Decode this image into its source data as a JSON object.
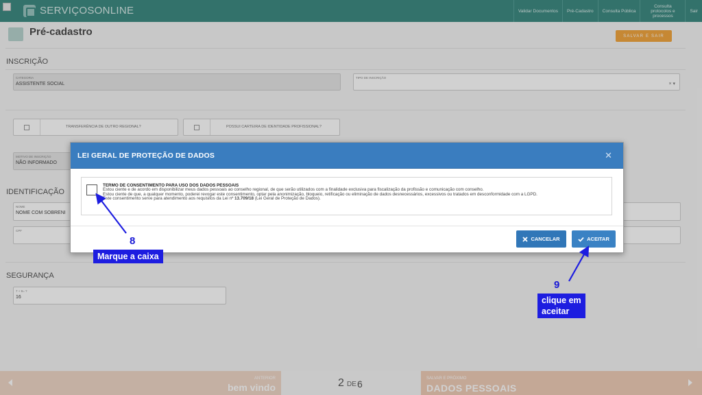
{
  "header": {
    "brand": "SERVIÇOSONLINE",
    "nav": [
      "Validar Documentos",
      "Pré-Cadastro",
      "Consulta Pública",
      "Consulta protocolos e processos",
      "Sair"
    ]
  },
  "page": {
    "title": "Pré-cadastro",
    "save_exit_label": "SALVAR E SAIR"
  },
  "inscricao": {
    "section_title": "INSCRIÇÃO",
    "categoria_label": "CATEGORIA",
    "categoria_value": "ASSISTENTE SOCIAL",
    "tipo_label": "TIPO DE INSCRIÇÃO",
    "tipo_clear": "× ▾",
    "transferencia_label": "TRANSFERÊNCIA DE OUTRO REGIONAL?",
    "carteira_label": "POSSUI CARTEIRA DE IDENTIDADE PROFISSIONAL?",
    "motivo_label": "MOTIVO DE INSCRIÇÃO",
    "motivo_value": "NÃO INFORMADO"
  },
  "identificacao": {
    "section_title": "IDENTIFICAÇÃO",
    "nome_label": "NOME",
    "nome_value": "NOME COM SOBRENI",
    "cpf_label": "CPF"
  },
  "seguranca": {
    "section_title": "SEGURANÇA",
    "captcha_label": "7 + 9= ?",
    "captcha_value": "16"
  },
  "modal": {
    "title": "LEI GERAL DE PROTEÇÃO DE DADOS",
    "consent_title": "TERMO DE CONSENTIMENTO PARA USO DOS DADOS PESSOAIS",
    "consent_p1": "Estou ciente e de acordo em disponibilizar meus dados pessoais ao conselho regional, de que serão utilizados com a finalidade exclusiva para fiscalização da profissão e comunicação com conselho.",
    "consent_p2": "Estou ciente de que, a qualquer momento, poderei revogar este consentimento, optar pela anonimização, bloqueio, retificação ou eliminação de dados desnecessários, excessivos ou tratados em desconformidade com a LGPD.",
    "consent_p3_pre": "Este consentimento serve para atendimento aos requisitos da Lei nº ",
    "consent_p3_law": "13.709/18",
    "consent_p3_post": " (Lei Geral de Proteção de Dados).",
    "cancel_label": "CANCELAR",
    "accept_label": "ACEITAR"
  },
  "annotations": {
    "step8_number": "8",
    "step8_text": "Marque a caixa",
    "step9_number": "9",
    "step9_line1": "clique em",
    "step9_line2": "aceitar"
  },
  "stepper": {
    "prev_small": "ANTERIOR",
    "prev_big": "bem vindo",
    "current": "2",
    "of_label": "DE",
    "total": "6",
    "next_small": "SALVAR E PRÓXIMO",
    "next_big": "DADOS PESSOAIS"
  },
  "colors": {
    "header": "#3f8c83",
    "modal_header": "#3a7dbf",
    "annotation": "#1d1de0",
    "save_button": "#f2a640"
  }
}
